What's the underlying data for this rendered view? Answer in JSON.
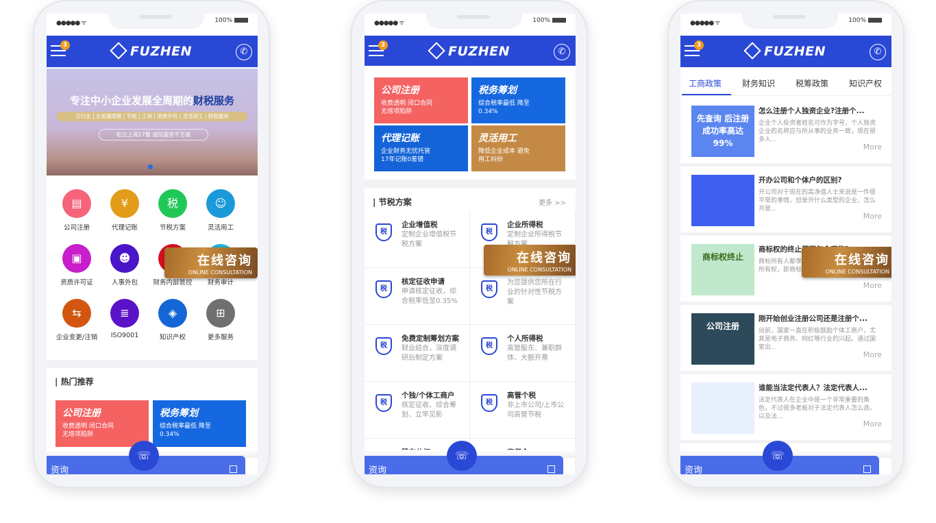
{
  "status_bar": {
    "signal": "●●●●● ᯤ",
    "battery": "100%"
  },
  "header": {
    "brand": "FUZHEN",
    "badge": "3"
  },
  "overlay": {
    "title": "在线咨询",
    "subtitle": "ONLINE CONSULTATION"
  },
  "bottom_bar": {
    "label": "资询"
  },
  "colors": {
    "brand_blue": "#2a48d6",
    "bar_blue": "#4a6ce8",
    "badge": "#f39a1e"
  },
  "phone1": {
    "banner": {
      "headline": "专注中小企业发展全周期的",
      "headline_highlight": "财税服务",
      "tags": "泛行业 | 全发展周期 | 节税 | 工商 | 资质许可 | 灵活用工 | 财税服务",
      "slogan": "屹立上海17载  诚信服务千万家"
    },
    "services": [
      {
        "label": "公司注册",
        "color": "#f5647a",
        "icon": "www-certificate-icon"
      },
      {
        "label": "代理记账",
        "color": "#e39c1a",
        "icon": "receipt-yen-icon"
      },
      {
        "label": "节税方案",
        "color": "#22c857",
        "icon": "tax-icon"
      },
      {
        "label": "灵活用工",
        "color": "#1a9ad8",
        "icon": "person-icon"
      },
      {
        "label": "资质许可证",
        "color": "#c81ecb",
        "icon": "document-badge-icon"
      },
      {
        "label": "人事外包",
        "color": "#4a16c9",
        "icon": "id-card-icon"
      },
      {
        "label": "财务内部管控",
        "color": "#d60f1f",
        "icon": "control-icon"
      },
      {
        "label": "财务审计",
        "color": "#1ab4d8",
        "icon": "audit-icon"
      },
      {
        "label": "企业变更/注销",
        "color": "#d2560f",
        "icon": "swap-icon"
      },
      {
        "label": "ISO9001",
        "color": "#5a12c9",
        "icon": "list-document-icon"
      },
      {
        "label": "知识产权",
        "color": "#1466d6",
        "icon": "layers-icon"
      },
      {
        "label": "更多服务",
        "color": "#707070",
        "icon": "grid-icon"
      }
    ],
    "hot_title": "热门推荐",
    "hot_cards": [
      {
        "title": "公司注册",
        "desc": "收费透明 闭口合同 无增项陷阱",
        "color": "#f46262"
      },
      {
        "title": "税务筹划",
        "desc": "综合税率最低 降至0.34%",
        "color": "#1668e0"
      }
    ]
  },
  "phone2": {
    "cards": [
      {
        "title": "公司注册",
        "desc": "收费透明 闭口合同 无增项陷阱",
        "color": "#f46262"
      },
      {
        "title": "税务筹划",
        "desc": "综合税率最低 降至0.34%",
        "color": "#1668e0"
      },
      {
        "title": "代理记账",
        "desc": "企业财务无忧托管 17年记账0差错",
        "color": "#1463d8"
      },
      {
        "title": "灵活用工",
        "desc": "降低企业成本 避免用工纠纷",
        "color": "#c48a45"
      }
    ],
    "section_title": "节税方案",
    "more": "更多 >>",
    "tax_icon_text": "税",
    "plans": [
      {
        "title": "企业增值税",
        "desc": "定制企业增值税节税方案"
      },
      {
        "title": "企业所得税",
        "desc": "定制企业所得税节税方案"
      },
      {
        "title": "核定征收申请",
        "desc": "申请核定征收，综合税率低至0.35%"
      },
      {
        "title": "",
        "desc": "为您提供您所在行业的针对性节税方案"
      },
      {
        "title": "免费定制筹划方案",
        "desc": "财业结合，深度调研后制定方案"
      },
      {
        "title": "个人所得税",
        "desc": "高管股东、兼职群体、大额开票"
      },
      {
        "title": "个独/个体工商户",
        "desc": "核定征收、综合筹划、立竿见影"
      },
      {
        "title": "高管个税",
        "desc": "非上市公司/上市公司高管节税"
      },
      {
        "title": "股东分红",
        "desc": ""
      },
      {
        "title": "高佣金",
        "desc": ""
      }
    ]
  },
  "phone3": {
    "tabs": [
      "工商政策",
      "财务知识",
      "税筹政策",
      "知识产权"
    ],
    "active_tab": 0,
    "more_label": "More",
    "articles": [
      {
        "title": "怎么注册个人独资企业?注册个...",
        "desc": "企业个人投资者姓名可作为字号，个人独资企业的名称应与所从事的业务一致，现在很多人...",
        "image_text": "先查询 后注册 成功率高达99%",
        "image_color": "#5b86f0"
      },
      {
        "title": "开办公司和个体户的区别?",
        "desc": "开公司对于现在的高净值人士来说是一件很平常的事情，但是开什么类型的企业，怎么开是...",
        "image_text": "",
        "image_color": "#3f5ff0"
      },
      {
        "title": "商标权的终止原因包含哪些?",
        "desc": "商标所有人都享有商标专用权，即对商标的所有权，即商标所有者对...",
        "image_text": "商标权终止",
        "image_color": "#bfe8cc"
      },
      {
        "title": "刚开始创业注册公司还是注册个...",
        "desc": "目前，国家一直在积极鼓励个体工商户，尤其是电子商务、网红等行业的兴起。通过国家出...",
        "image_text": "公司注册",
        "image_color": "#2c4a5a"
      },
      {
        "title": "谁能当法定代表人？法定代表人...",
        "desc": "法定代表人在企业中是一个非常重要的角色，不过很多老板对于法定代表人怎么选，以及法...",
        "image_text": "",
        "image_color": "#e8f0fb"
      }
    ]
  }
}
